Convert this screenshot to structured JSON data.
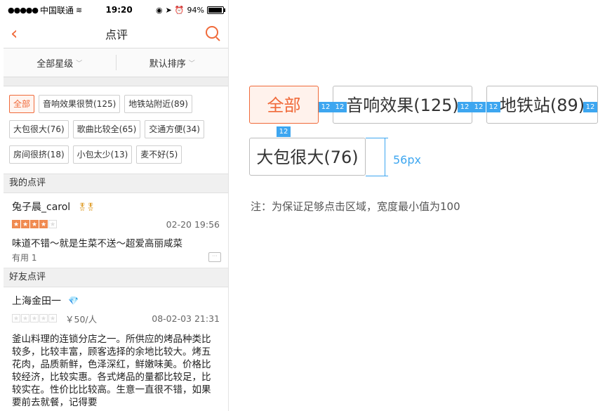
{
  "status": {
    "carrier": "中国联通",
    "time": "19:20",
    "battery": "94%",
    "battery_level": 94
  },
  "nav": {
    "title": "点评"
  },
  "filters": {
    "star": "全部星级",
    "sort": "默认排序"
  },
  "tags": [
    [
      "全部",
      "音响效果很赞(125)",
      "地铁站附近(89)"
    ],
    [
      "大包很大(76)",
      "歌曲比较全(65)",
      "交通方便(34)"
    ],
    [
      "房间很挤(18)",
      "小包太少(13)",
      "麦不好(5)"
    ]
  ],
  "my_review": {
    "section": "我的点评",
    "user": "兔子晨_carol",
    "rating": 4,
    "time": "02-20 19:56",
    "text": "味道不错～就是生菜不送～超爱高丽咸菜",
    "useful": "有用 1"
  },
  "friend_review": {
    "section": "好友点评",
    "user": "上海金田一",
    "rating": 0,
    "price": "￥50/人",
    "time": "08-02-03 21:31",
    "text": "釜山料理的连锁分店之一。所供应的烤品种类比较多，比较丰富，顾客选择的余地比较大。烤五花肉，品质新鲜，色泽深红，鲜嫩味美。价格比较经济，比较实惠。各式烤品的量都比较足，比较实在。性价比比较高。生意一直很不错，如果要前去就餐，记得要"
  },
  "spec": {
    "tags": [
      "全部",
      "音响效果(125)",
      "地铁站(89)",
      "大包很大(76)"
    ],
    "spacing": "12",
    "height_label": "56px",
    "note": "注：为保证足够点击区域，宽度最小值为100"
  },
  "colors": {
    "accent": "#f06a3a",
    "marker": "#3da6f0"
  }
}
